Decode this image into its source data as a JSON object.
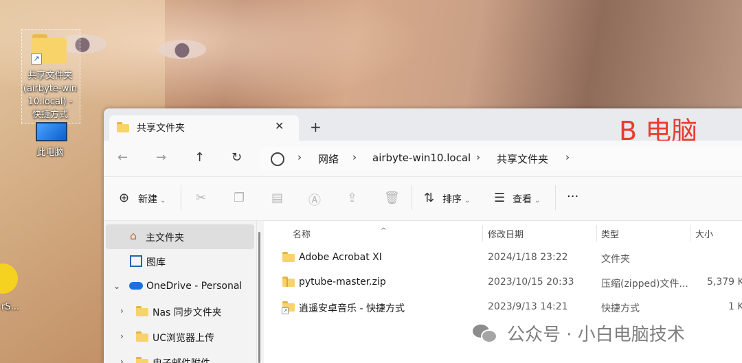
{
  "desktop": {
    "shortcut_label_1": "共享文件夹",
    "shortcut_label_2": "(airbyte-win",
    "shortcut_label_3": "10.local) -",
    "shortcut_label_4": "快捷方式",
    "this_pc_label": "此电脑",
    "partial_label": "rS..."
  },
  "window": {
    "tab_title": "共享文件夹",
    "annotation": "B 电脑",
    "breadcrumb": [
      "网络",
      "airbyte-win10.local",
      "共享文件夹"
    ],
    "toolbar": {
      "new_label": "新建",
      "sort_label": "排序",
      "view_label": "查看",
      "more_label": "···"
    },
    "sidebar": {
      "items": [
        {
          "label": "主文件夹"
        },
        {
          "label": "图库"
        },
        {
          "label": "OneDrive - Personal"
        },
        {
          "label": "Nas 同步文件夹"
        },
        {
          "label": "UC浏览器上传"
        },
        {
          "label": "电子邮件附件"
        }
      ]
    },
    "columns": [
      "名称",
      "修改日期",
      "类型",
      "大小"
    ],
    "files": [
      {
        "name": "Adobe Acrobat XI",
        "date": "2024/1/18 23:22",
        "type": "文件夹",
        "size": ""
      },
      {
        "name": "pytube-master.zip",
        "date": "2023/10/15 20:33",
        "type": "压缩(zipped)文件...",
        "size": "5,379 K"
      },
      {
        "name": "逍遥安卓音乐 - 快捷方式",
        "date": "2023/9/13 14:21",
        "type": "快捷方式",
        "size": "1 K"
      }
    ]
  },
  "watermark": "公众号 · 小白电脑技术",
  "colors": {
    "annotation": "#ec3b2f",
    "folder": "#f8d36a",
    "selected": "#dedede"
  }
}
